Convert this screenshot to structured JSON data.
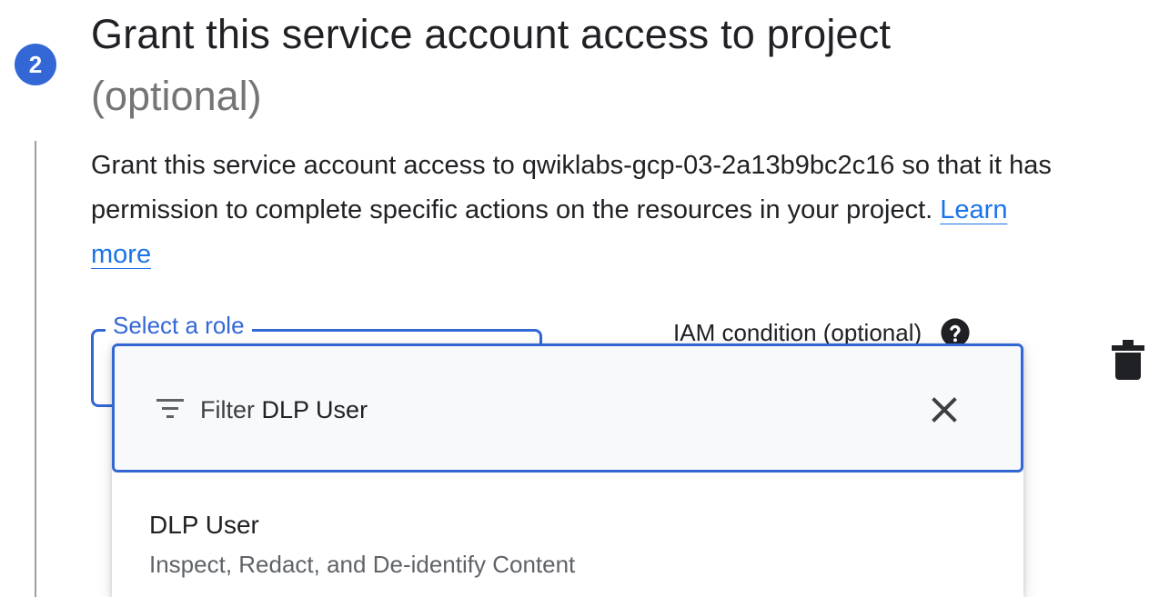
{
  "step": {
    "number": "2",
    "title": "Grant this service account access to project",
    "optional": "(optional)"
  },
  "description": {
    "line1": "Grant this service account access to qwiklabs-gcp-03-2a13b9bc2c16 so that it has",
    "line2_prefix": "permission to complete specific actions on the resources in your project. ",
    "link_part1": "Learn",
    "link_part2": "more"
  },
  "role_field": {
    "label": "Select a role"
  },
  "iam_condition": {
    "label": "IAM condition (optional)",
    "icon": "help-icon"
  },
  "delete": {
    "icon": "trash-icon"
  },
  "dropdown": {
    "filter_label": "Filter",
    "filter_value": "DLP User",
    "filter_icon": "filter-list-icon",
    "clear_icon": "close-icon",
    "options": [
      {
        "title": "DLP User",
        "subtitle": "Inspect, Redact, and De-identify Content"
      }
    ]
  },
  "colors": {
    "accent": "#3367d6",
    "link": "#1a73e8",
    "secondary_text": "#5f6368"
  }
}
